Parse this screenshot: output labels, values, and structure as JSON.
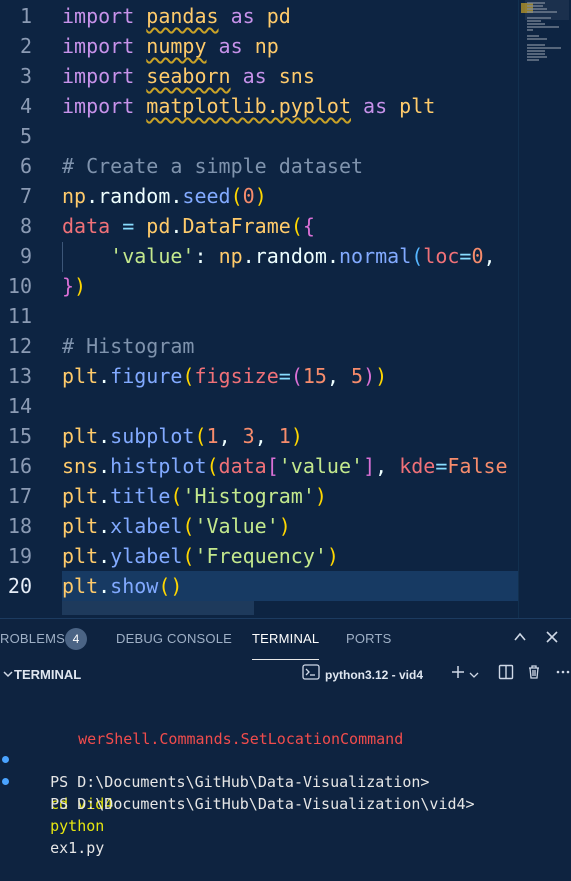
{
  "editor": {
    "lines": [
      {
        "num": "1",
        "tokens": [
          {
            "t": "import",
            "c": "k"
          },
          {
            "t": " ",
            "c": "w"
          },
          {
            "t": "pandas",
            "c": "m"
          },
          {
            "t": " as ",
            "c": "k"
          },
          {
            "t": "pd",
            "c": "mp"
          }
        ]
      },
      {
        "num": "2",
        "tokens": [
          {
            "t": "import",
            "c": "k"
          },
          {
            "t": " ",
            "c": "w"
          },
          {
            "t": "numpy",
            "c": "m"
          },
          {
            "t": " as ",
            "c": "k"
          },
          {
            "t": "np",
            "c": "mp"
          }
        ]
      },
      {
        "num": "3",
        "tokens": [
          {
            "t": "import",
            "c": "k"
          },
          {
            "t": " ",
            "c": "w"
          },
          {
            "t": "seaborn",
            "c": "m"
          },
          {
            "t": " as ",
            "c": "k"
          },
          {
            "t": "sns",
            "c": "mp"
          }
        ]
      },
      {
        "num": "4",
        "tokens": [
          {
            "t": "import",
            "c": "k"
          },
          {
            "t": " ",
            "c": "w"
          },
          {
            "t": "matplotlib.pyplot",
            "c": "m"
          },
          {
            "t": " as ",
            "c": "k"
          },
          {
            "t": "plt",
            "c": "mp"
          }
        ]
      },
      {
        "num": "5",
        "tokens": []
      },
      {
        "num": "6",
        "tokens": [
          {
            "t": "# Create a simple dataset",
            "c": "c"
          }
        ]
      },
      {
        "num": "7",
        "tokens": [
          {
            "t": "np",
            "c": "mp"
          },
          {
            "t": ".random.",
            "c": "w"
          },
          {
            "t": "seed",
            "c": "f"
          },
          {
            "t": "(",
            "c": "p1"
          },
          {
            "t": "0",
            "c": "n"
          },
          {
            "t": ")",
            "c": "p1"
          }
        ]
      },
      {
        "num": "8",
        "tokens": [
          {
            "t": "data",
            "c": "v"
          },
          {
            "t": " = ",
            "c": "op"
          },
          {
            "t": "pd",
            "c": "mp"
          },
          {
            "t": ".",
            "c": "w"
          },
          {
            "t": "DataFrame",
            "c": "mp"
          },
          {
            "t": "(",
            "c": "p1"
          },
          {
            "t": "{",
            "c": "p2"
          }
        ]
      },
      {
        "num": "9",
        "tokens": [
          {
            "t": "    ",
            "c": "w"
          },
          {
            "t": "'value'",
            "c": "s"
          },
          {
            "t": ": ",
            "c": "w"
          },
          {
            "t": "np",
            "c": "mp"
          },
          {
            "t": ".random.",
            "c": "w"
          },
          {
            "t": "normal",
            "c": "f"
          },
          {
            "t": "(",
            "c": "p3"
          },
          {
            "t": "loc",
            "c": "v"
          },
          {
            "t": "=",
            "c": "op"
          },
          {
            "t": "0",
            "c": "n"
          },
          {
            "t": ",",
            "c": "w"
          }
        ]
      },
      {
        "num": "10",
        "tokens": [
          {
            "t": "}",
            "c": "p2"
          },
          {
            "t": ")",
            "c": "p1"
          }
        ]
      },
      {
        "num": "11",
        "tokens": []
      },
      {
        "num": "12",
        "tokens": [
          {
            "t": "# Histogram",
            "c": "c"
          }
        ]
      },
      {
        "num": "13",
        "tokens": [
          {
            "t": "plt",
            "c": "mp"
          },
          {
            "t": ".",
            "c": "w"
          },
          {
            "t": "figure",
            "c": "f"
          },
          {
            "t": "(",
            "c": "p1"
          },
          {
            "t": "figsize",
            "c": "v"
          },
          {
            "t": "=",
            "c": "op"
          },
          {
            "t": "(",
            "c": "p2"
          },
          {
            "t": "15",
            "c": "n"
          },
          {
            "t": ", ",
            "c": "w"
          },
          {
            "t": "5",
            "c": "n"
          },
          {
            "t": ")",
            "c": "p2"
          },
          {
            "t": ")",
            "c": "p1"
          }
        ]
      },
      {
        "num": "14",
        "tokens": []
      },
      {
        "num": "15",
        "tokens": [
          {
            "t": "plt",
            "c": "mp"
          },
          {
            "t": ".",
            "c": "w"
          },
          {
            "t": "subplot",
            "c": "f"
          },
          {
            "t": "(",
            "c": "p1"
          },
          {
            "t": "1",
            "c": "n"
          },
          {
            "t": ", ",
            "c": "w"
          },
          {
            "t": "3",
            "c": "n"
          },
          {
            "t": ", ",
            "c": "w"
          },
          {
            "t": "1",
            "c": "n"
          },
          {
            "t": ")",
            "c": "p1"
          }
        ]
      },
      {
        "num": "16",
        "tokens": [
          {
            "t": "sns",
            "c": "mp"
          },
          {
            "t": ".",
            "c": "w"
          },
          {
            "t": "histplot",
            "c": "f"
          },
          {
            "t": "(",
            "c": "p1"
          },
          {
            "t": "data",
            "c": "v"
          },
          {
            "t": "[",
            "c": "p2"
          },
          {
            "t": "'value'",
            "c": "s"
          },
          {
            "t": "]",
            "c": "p2"
          },
          {
            "t": ", ",
            "c": "w"
          },
          {
            "t": "kde",
            "c": "v"
          },
          {
            "t": "=",
            "c": "op"
          },
          {
            "t": "False",
            "c": "n"
          }
        ]
      },
      {
        "num": "17",
        "tokens": [
          {
            "t": "plt",
            "c": "mp"
          },
          {
            "t": ".",
            "c": "w"
          },
          {
            "t": "title",
            "c": "f"
          },
          {
            "t": "(",
            "c": "p1"
          },
          {
            "t": "'Histogram'",
            "c": "s"
          },
          {
            "t": ")",
            "c": "p1"
          }
        ]
      },
      {
        "num": "18",
        "tokens": [
          {
            "t": "plt",
            "c": "mp"
          },
          {
            "t": ".",
            "c": "w"
          },
          {
            "t": "xlabel",
            "c": "f"
          },
          {
            "t": "(",
            "c": "p1"
          },
          {
            "t": "'Value'",
            "c": "s"
          },
          {
            "t": ")",
            "c": "p1"
          }
        ]
      },
      {
        "num": "19",
        "tokens": [
          {
            "t": "plt",
            "c": "mp"
          },
          {
            "t": ".",
            "c": "w"
          },
          {
            "t": "ylabel",
            "c": "f"
          },
          {
            "t": "(",
            "c": "p1"
          },
          {
            "t": "'Frequency'",
            "c": "s"
          },
          {
            "t": ")",
            "c": "p1"
          }
        ]
      },
      {
        "num": "20",
        "tokens": [
          {
            "t": "plt",
            "c": "mp"
          },
          {
            "t": ".",
            "c": "w"
          },
          {
            "t": "show",
            "c": "f"
          },
          {
            "t": "(",
            "c": "p1"
          },
          {
            "t": ")",
            "c": "p1"
          }
        ]
      }
    ],
    "active_line": "20"
  },
  "panel": {
    "tabs": [
      {
        "label": "ROBLEMS",
        "badge": "4"
      },
      {
        "label": "DEBUG CONSOLE"
      },
      {
        "label": "TERMINAL"
      },
      {
        "label": "PORTS"
      }
    ],
    "active_tab": "TERMINAL"
  },
  "terminal_header": {
    "title": "TERMINAL",
    "shell": "python3.12 - vid4",
    "icons": [
      "chevron-down-icon",
      "terminal-icon",
      "add-icon",
      "split-icon",
      "trash-icon",
      "more-icon"
    ]
  },
  "terminal": {
    "lines": [
      {
        "text": "werShell.Commands.SetLocationCommand",
        "color": "#f14c4c"
      },
      {
        "prompt": "PS D:\\Documents\\GitHub\\Data-Visualization>",
        "command": "cd vid4"
      },
      {
        "prompt": "PS D:\\Documents\\GitHub\\Data-Visualization\\vid4>",
        "command": "python",
        "arg": "ex1.py"
      }
    ]
  },
  "colors": {
    "background": "#0d2442",
    "keyword": "#c792ea",
    "module": "#ffcb6b",
    "string": "#c3e88d",
    "number": "#f78c6c",
    "function": "#82aaff",
    "comment": "#7f93ad",
    "error": "#f14c4c"
  }
}
